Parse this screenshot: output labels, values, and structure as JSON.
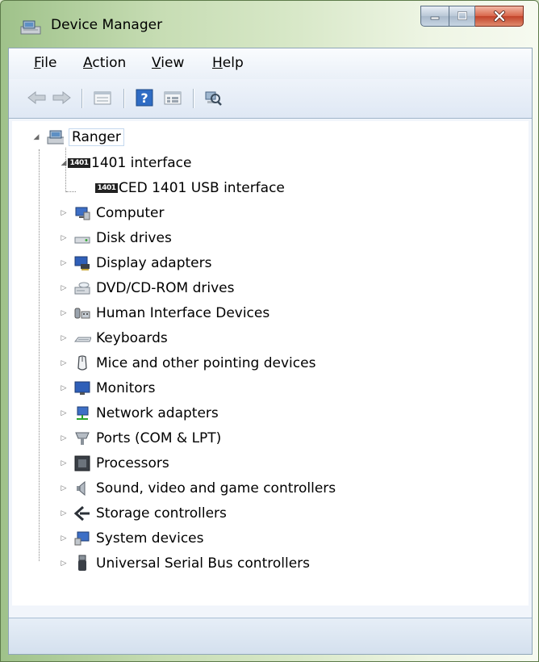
{
  "window": {
    "title": "Device Manager",
    "icon": "device-manager-icon",
    "caption_buttons": [
      "minimize-icon",
      "maximize-icon",
      "close-icon"
    ]
  },
  "menu": [
    {
      "label": "File",
      "accel": "F"
    },
    {
      "label": "Action",
      "accel": "A"
    },
    {
      "label": "View",
      "accel": "V"
    },
    {
      "label": "Help",
      "accel": "H"
    }
  ],
  "toolbar": [
    "back-arrow-icon",
    "forward-arrow-icon",
    "properties-icon",
    "help-icon",
    "details-icon",
    "scan-hardware-icon"
  ],
  "tree": {
    "root": {
      "label": "Ranger",
      "icon": "computer-icon",
      "expanded": true,
      "selected": true
    },
    "expanded_category": {
      "label": "1401 interface",
      "icon": "1401-chip-icon",
      "chip_text": "1401"
    },
    "expanded_child": {
      "label": "CED 1401 USB interface",
      "icon": "1401-chip-icon",
      "chip_text": "1401"
    },
    "categories": [
      {
        "label": "Computer",
        "icon": "computer-monitor-icon"
      },
      {
        "label": "Disk drives",
        "icon": "disk-drive-icon"
      },
      {
        "label": "Display adapters",
        "icon": "display-adapter-icon"
      },
      {
        "label": "DVD/CD-ROM drives",
        "icon": "dvd-drive-icon"
      },
      {
        "label": "Human Interface Devices",
        "icon": "hid-icon"
      },
      {
        "label": "Keyboards",
        "icon": "keyboard-icon"
      },
      {
        "label": "Mice and other pointing devices",
        "icon": "mouse-icon"
      },
      {
        "label": "Monitors",
        "icon": "monitor-icon"
      },
      {
        "label": "Network adapters",
        "icon": "network-adapter-icon"
      },
      {
        "label": "Ports (COM & LPT)",
        "icon": "port-icon"
      },
      {
        "label": "Processors",
        "icon": "processor-icon"
      },
      {
        "label": "Sound, video and game controllers",
        "icon": "speaker-icon"
      },
      {
        "label": "Storage controllers",
        "icon": "storage-controller-icon"
      },
      {
        "label": "System devices",
        "icon": "system-device-icon"
      },
      {
        "label": "Universal Serial Bus controllers",
        "icon": "usb-icon"
      }
    ]
  }
}
